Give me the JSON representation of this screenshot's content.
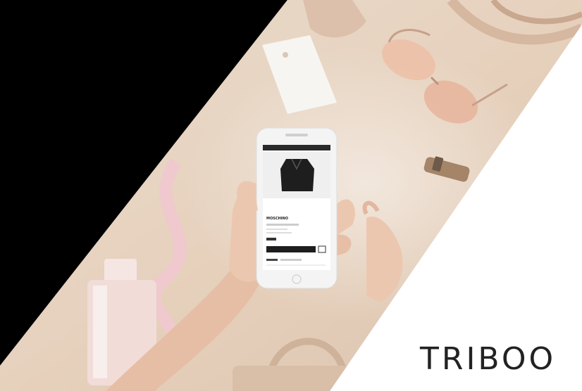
{
  "brand": {
    "name": "TRIBOO"
  },
  "colors": {
    "left_panel": "#000000",
    "right_panel": "#ffffff",
    "table_surface": "#e8d6c4",
    "table_shadow": "#d9c2ad",
    "phone_body": "#f4f4f4",
    "phone_screen": "#ffffff",
    "garment": "#1e1e1e",
    "skin": "#e9c4ad",
    "perfume_bottle": "#f1dcd8",
    "ribbon": "#f0c8cf",
    "sunglasses_lens": "#e8b49a",
    "brand_text": "#222222"
  },
  "phone": {
    "screen_title": "MOSCHINO"
  }
}
